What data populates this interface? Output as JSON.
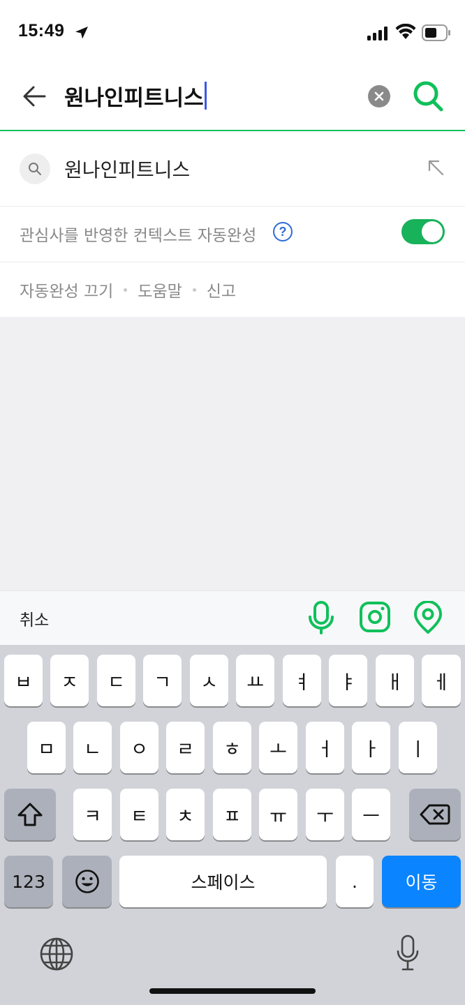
{
  "status_bar": {
    "time": "15:49",
    "icons": [
      "location-arrow-icon",
      "cell-signal-icon",
      "wifi-icon",
      "battery-icon"
    ]
  },
  "search": {
    "query": "원나인피트니스",
    "icons": [
      "back-arrow-icon",
      "clear-icon",
      "search-icon"
    ]
  },
  "suggestions": [
    {
      "text": "원나인피트니스"
    }
  ],
  "context": {
    "label": "관심사를 반영한 컨텍스트 자동완성",
    "help": "?",
    "enabled": true
  },
  "links": [
    "자동완성 끄기",
    "도움말",
    "신고"
  ],
  "accessory": {
    "cancel": "취소",
    "icons": [
      "voice-search-icon",
      "lens-search-icon",
      "place-search-icon"
    ]
  },
  "keyboard": {
    "row1": [
      "ㅂ",
      "ㅈ",
      "ㄷ",
      "ㄱ",
      "ㅅ",
      "ㅛ",
      "ㅕ",
      "ㅑ",
      "ㅐ",
      "ㅔ"
    ],
    "row2": [
      "ㅁ",
      "ㄴ",
      "ㅇ",
      "ㄹ",
      "ㅎ",
      "ㅗ",
      "ㅓ",
      "ㅏ",
      "ㅣ"
    ],
    "row3": [
      "ㅋ",
      "ㅌ",
      "ㅊ",
      "ㅍ",
      "ㅠ",
      "ㅜ",
      "ㅡ"
    ],
    "numbers": "123",
    "space": "스페이스",
    "period": ".",
    "go": "이동"
  },
  "colors": {
    "accent_green": "#10c05a",
    "key_blue": "#0a84ff",
    "help_blue": "#2f6bd6"
  }
}
